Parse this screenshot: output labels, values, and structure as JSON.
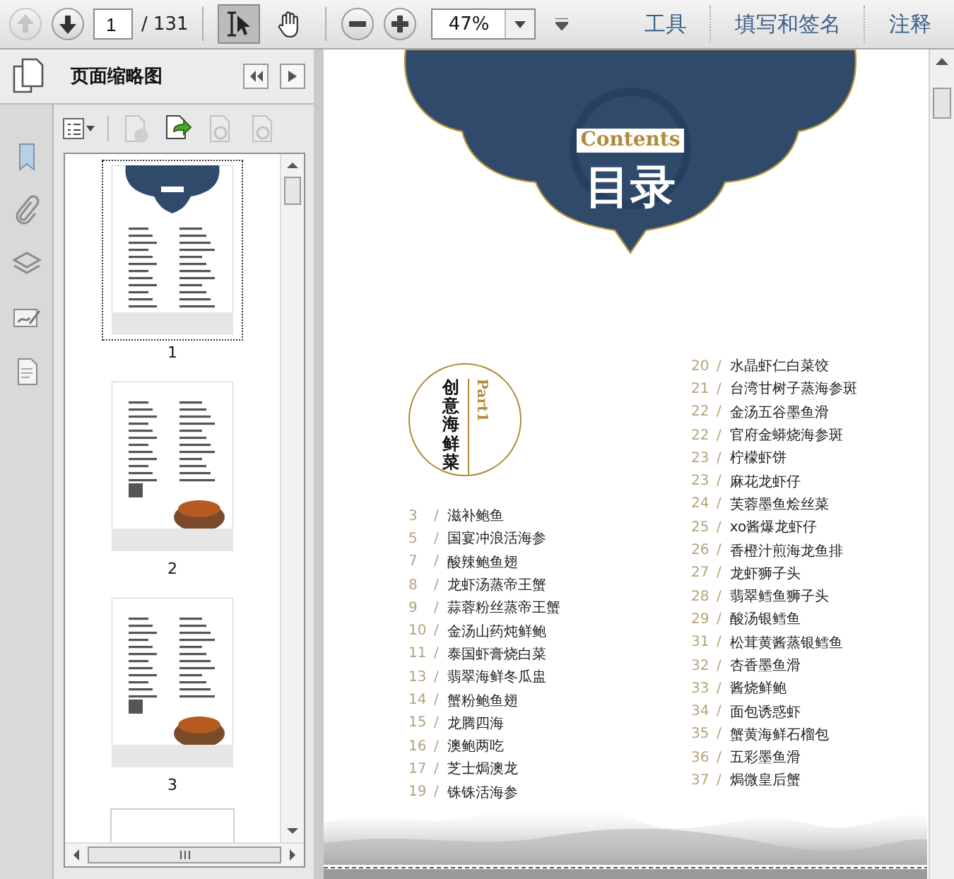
{
  "toolbar": {
    "prev_page": {
      "disabled": true
    },
    "next_page": {
      "disabled": false
    },
    "page_field": {
      "value": "1"
    },
    "page_total": "/ 131",
    "tools": [
      {
        "kind": "select",
        "selected": true
      },
      {
        "kind": "hand",
        "selected": false
      }
    ],
    "zoom_field": {
      "value": "47%"
    },
    "panels": [
      "工具",
      "填写和签名",
      "注释"
    ]
  },
  "sidebar": {
    "title": "页面缩略图",
    "thumbnails": [
      {
        "label": "1",
        "kind": "contents",
        "selected": true
      },
      {
        "label": "2",
        "kind": "dish",
        "selected": false
      },
      {
        "label": "3",
        "kind": "dish",
        "selected": false
      }
    ]
  },
  "page": {
    "banner_label": "Contents",
    "banner_title": "目录",
    "part_label": "Part1",
    "part_title": "创意海鲜菜",
    "left_entries": [
      {
        "page": "3",
        "separator": "/",
        "title": "滋补鲍鱼"
      },
      {
        "page": "5",
        "separator": "/",
        "title": "国宴冲浪活海参"
      },
      {
        "page": "7",
        "separator": "/",
        "title": "酸辣鲍鱼翅"
      },
      {
        "page": "8",
        "separator": "/",
        "title": "龙虾汤蒸帝王蟹"
      },
      {
        "page": "9",
        "separator": "/",
        "title": "蒜蓉粉丝蒸帝王蟹"
      },
      {
        "page": "10",
        "separator": "/",
        "title": "金汤山药炖鲜鲍"
      },
      {
        "page": "11",
        "separator": "/",
        "title": "泰国虾膏烧白菜"
      },
      {
        "page": "13",
        "separator": "/",
        "title": "翡翠海鲜冬瓜盅"
      },
      {
        "page": "14",
        "separator": "/",
        "title": "蟹粉鲍鱼翅"
      },
      {
        "page": "15",
        "separator": "/",
        "title": "龙腾四海"
      },
      {
        "page": "16",
        "separator": "/",
        "title": "澳鲍两吃"
      },
      {
        "page": "17",
        "separator": "/",
        "title": "芝士焗澳龙"
      },
      {
        "page": "19",
        "separator": "/",
        "title": "铢铢活海参"
      }
    ],
    "right_entries": [
      {
        "page": "20",
        "separator": "/",
        "title": "水晶虾仁白菜饺"
      },
      {
        "page": "21",
        "separator": "/",
        "title": "台湾甘树子蒸海参斑"
      },
      {
        "page": "22",
        "separator": "/",
        "title": "金汤五谷墨鱼滑"
      },
      {
        "page": "22",
        "separator": "/",
        "title": "官府金蟒烧海参斑"
      },
      {
        "page": "23",
        "separator": "/",
        "title": "柠檬虾饼"
      },
      {
        "page": "23",
        "separator": "/",
        "title": "麻花龙虾仔"
      },
      {
        "page": "24",
        "separator": "/",
        "title": "芙蓉墨鱼烩丝菜"
      },
      {
        "page": "25",
        "separator": "/",
        "title": "xo酱爆龙虾仔"
      },
      {
        "page": "26",
        "separator": "/",
        "title": "香橙汁煎海龙鱼排"
      },
      {
        "page": "27",
        "separator": "/",
        "title": "龙虾狮子头"
      },
      {
        "page": "28",
        "separator": "/",
        "title": "翡翠鳕鱼狮子头"
      },
      {
        "page": "29",
        "separator": "/",
        "title": "酸汤银鳕鱼"
      },
      {
        "page": "31",
        "separator": "/",
        "title": "松茸黄酱蒸银鳕鱼"
      },
      {
        "page": "32",
        "separator": "/",
        "title": "杏香墨鱼滑"
      },
      {
        "page": "33",
        "separator": "/",
        "title": "酱烧鲜鲍"
      },
      {
        "page": "34",
        "separator": "/",
        "title": "面包诱惑虾"
      },
      {
        "page": "35",
        "separator": "/",
        "title": "蟹黄海鲜石榴包"
      },
      {
        "page": "36",
        "separator": "/",
        "title": "五彩墨鱼滑"
      },
      {
        "page": "37",
        "separator": "/",
        "title": "焗微皇后蟹"
      }
    ]
  }
}
